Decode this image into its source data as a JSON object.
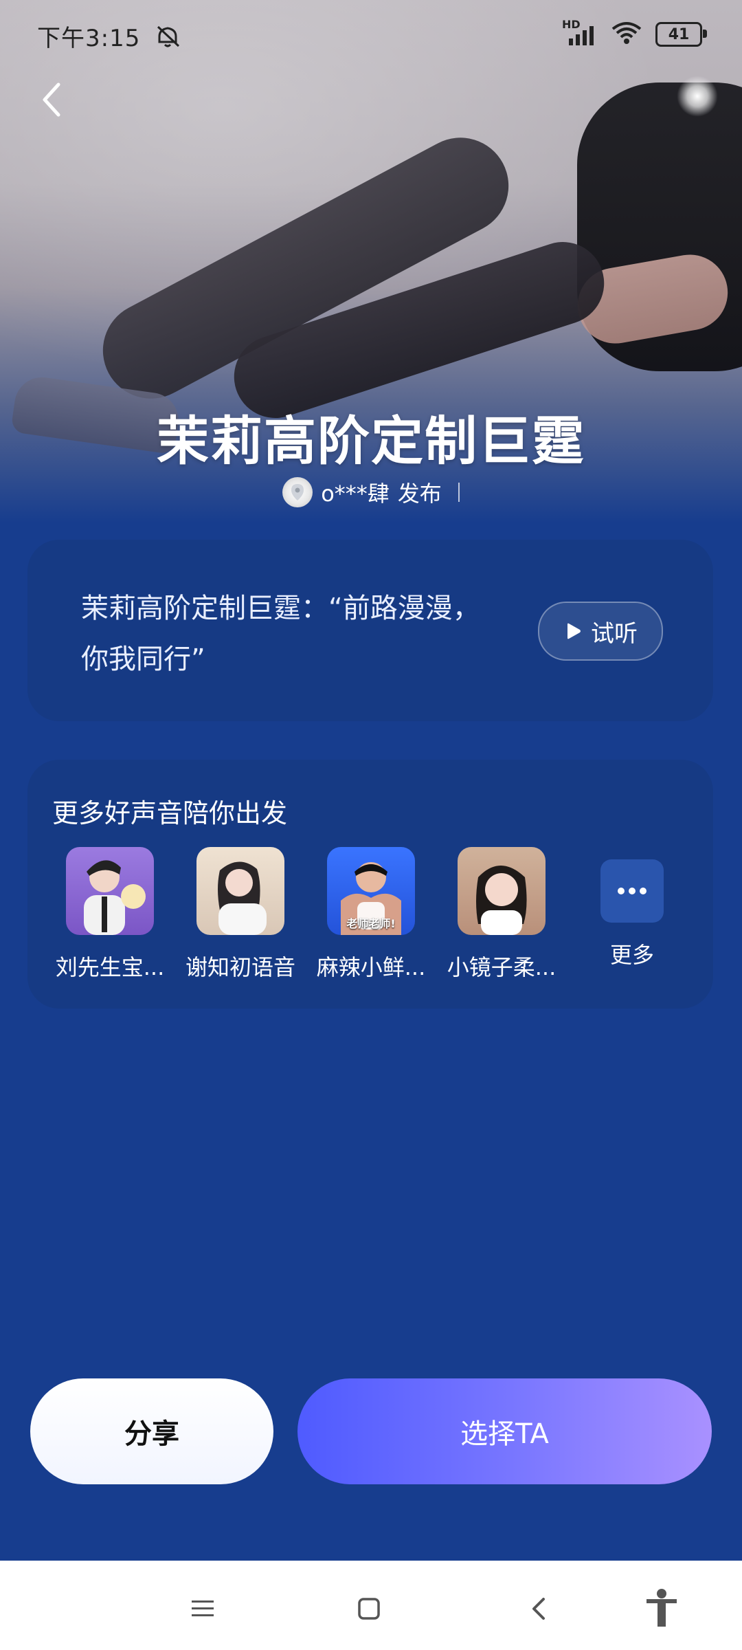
{
  "status_bar": {
    "time": "下午3:15",
    "signal_badge": "HD",
    "battery": "41"
  },
  "header": {
    "back_icon": "chevron-left-icon",
    "title": "茉莉高阶定制巨霆",
    "publisher_name": "o***肆",
    "published_label": "发布"
  },
  "quote_card": {
    "quote_line1": "茉莉高阶定制巨霆：“前路漫漫，",
    "quote_line2": "你我同行”",
    "listen_label": "试听"
  },
  "more_voices": {
    "title": "更多好声音陪你出发",
    "items": [
      {
        "label": "刘先生宝...",
        "avatar_bg": "#8f6bd6"
      },
      {
        "label": "谢知初语音",
        "avatar_bg": "#e8d9cb"
      },
      {
        "label": "麻辣小鲜...",
        "avatar_bg": "#2f66f2",
        "avatar_text": "老师老师!"
      },
      {
        "label": "小镜子柔...",
        "avatar_bg": "#caa58e"
      }
    ],
    "more_label": "更多"
  },
  "actions": {
    "share_label": "分享",
    "choose_label": "选择TA"
  },
  "nav": {
    "menu_icon": "menu-icon",
    "home_icon": "home-square-icon",
    "back_icon": "back-icon",
    "accessibility_icon": "accessibility-icon"
  }
}
